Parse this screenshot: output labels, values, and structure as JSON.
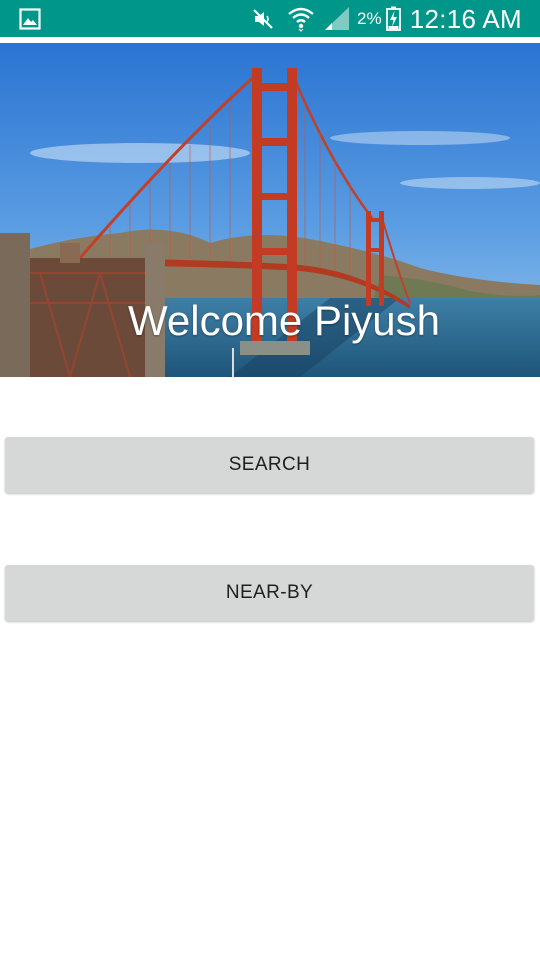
{
  "status_bar": {
    "battery_percent": "2%",
    "time": "12:16 AM",
    "icons": [
      "gallery-icon",
      "mute-icon",
      "wifi-icon",
      "signal-icon",
      "battery-charging-icon"
    ],
    "background_color": "#00968a"
  },
  "hero": {
    "welcome_text": "Welcome Piyush",
    "image": "golden-gate-bridge-photo"
  },
  "buttons": {
    "search_label": "SEARCH",
    "nearby_label": "NEAR-BY",
    "background_color": "#d6d7d7"
  }
}
